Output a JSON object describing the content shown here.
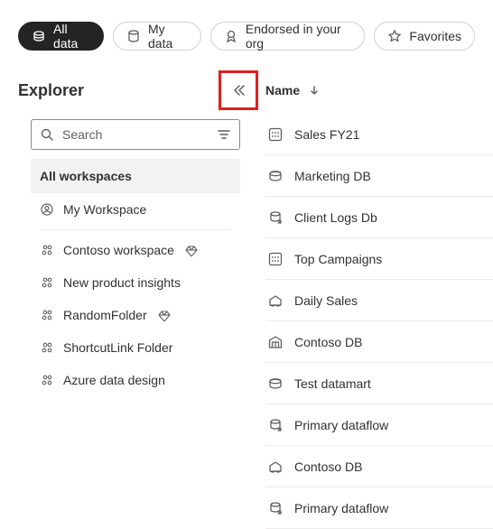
{
  "filters": {
    "all_data": "All data",
    "my_data": "My data",
    "endorsed": "Endorsed in your org",
    "favorites": "Favorites"
  },
  "explorer": {
    "title": "Explorer",
    "search_placeholder": "Search",
    "all_workspaces": "All workspaces",
    "items": [
      {
        "label": "My Workspace",
        "icon": "person",
        "diamond": false
      },
      {
        "label": "Contoso workspace",
        "icon": "group",
        "diamond": true
      },
      {
        "label": "New product insights",
        "icon": "group",
        "diamond": false
      },
      {
        "label": "RandomFolder",
        "icon": "group",
        "diamond": true
      },
      {
        "label": "ShortcutLink Folder",
        "icon": "group",
        "diamond": false
      },
      {
        "label": "Azure data design",
        "icon": "group",
        "diamond": false
      }
    ]
  },
  "list": {
    "column_name": "Name",
    "items": [
      {
        "label": "Sales FY21",
        "icon": "dataset"
      },
      {
        "label": "Marketing DB",
        "icon": "datamart"
      },
      {
        "label": "Client Logs Db",
        "icon": "dataflow"
      },
      {
        "label": "Top Campaigns",
        "icon": "dataset"
      },
      {
        "label": "Daily Sales",
        "icon": "lakehouse"
      },
      {
        "label": "Contoso DB",
        "icon": "warehouse"
      },
      {
        "label": "Test datamart",
        "icon": "datamart"
      },
      {
        "label": "Primary dataflow",
        "icon": "dataflow"
      },
      {
        "label": "Contoso DB",
        "icon": "lakehouse"
      },
      {
        "label": "Primary dataflow",
        "icon": "dataflow"
      }
    ]
  }
}
